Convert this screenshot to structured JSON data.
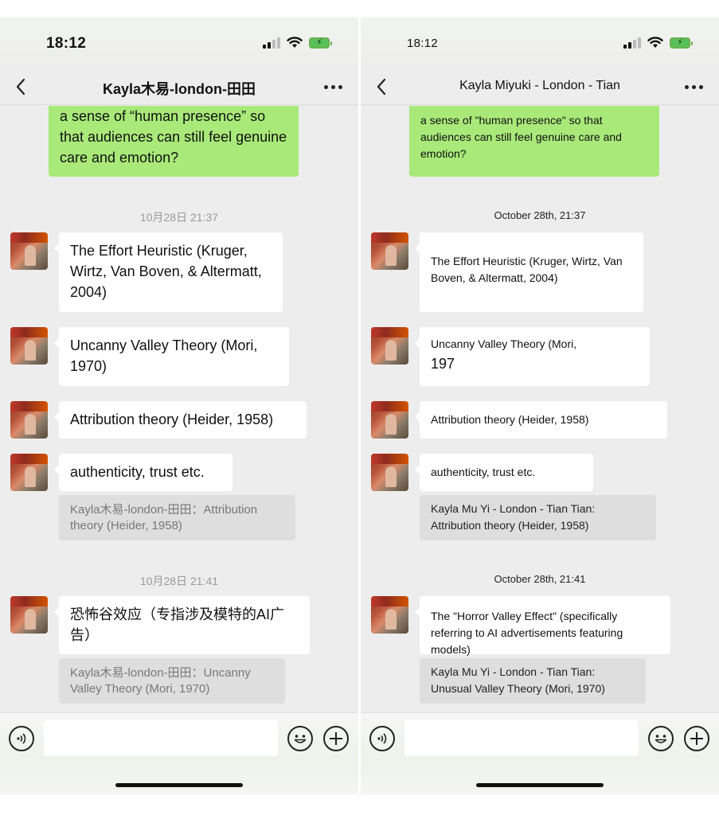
{
  "left": {
    "status": {
      "time": "18:12"
    },
    "nav": {
      "title": "Kayla木易-london-田田"
    },
    "messages": {
      "outgoing_1": "a sense of “human presence” so that audiences can still feel genuine care and emotion?",
      "timestamp_1": "10月28日 21:37",
      "in_1": "The Effort Heuristic (Kruger, Wirtz, Van Boven, & Altermatt, 2004)",
      "in_2": "Uncanny Valley Theory (Mori, 1970)",
      "in_3": "Attribution theory (Heider, 1958)",
      "in_4": "authenticity, trust etc.",
      "quote_1": "Kayla木易-london-田田：Attribution theory (Heider, 1958)",
      "timestamp_2": "10月28日 21:41",
      "in_5": "恐怖谷效应（专指涉及模特的AI广告）",
      "quote_2": "Kayla木易-london-田田：Uncanny Valley Theory (Mori, 1970)"
    },
    "input": {
      "value": ""
    }
  },
  "right": {
    "status": {
      "time": "18:12"
    },
    "nav": {
      "title": "Kayla Miyuki - London - Tian"
    },
    "messages": {
      "outgoing_1": "a sense of \"human presence\"  so that audiences can still feel genuine care and emotion?",
      "timestamp_1": "October 28th, 21:37",
      "in_1": "The Effort Heuristic (Kruger, Wirtz, Van Boven, & Altermatt, 2004)",
      "in_2_line1": "Uncanny Valley Theory (Mori,",
      "in_2_line2": "197",
      "in_3": "Attribution theory (Heider, 1958)",
      "in_4": "authenticity, trust etc.",
      "quote_1": "Kayla Mu Yi - London - Tian Tian: Attribution theory (Heider, 1958)",
      "timestamp_2": "October 28th, 21:41",
      "in_5": "The \"Horror Valley Effect\" (specifically referring to AI advertisements featuring models)",
      "quote_2": "Kayla Mu Yi - London - Tian Tian: Unusual Valley Theory (Mori, 1970)"
    },
    "input": {
      "value": ""
    }
  },
  "colors": {
    "outgoing_bubble": "#a9e97a",
    "incoming_bubble": "#ffffff",
    "chat_background": "#ededed",
    "quote_background": "#dedede"
  },
  "icons": [
    "back-icon",
    "more-icon",
    "voice-icon",
    "emoji-icon",
    "plus-icon",
    "signal-icon",
    "wifi-icon",
    "battery-icon"
  ]
}
